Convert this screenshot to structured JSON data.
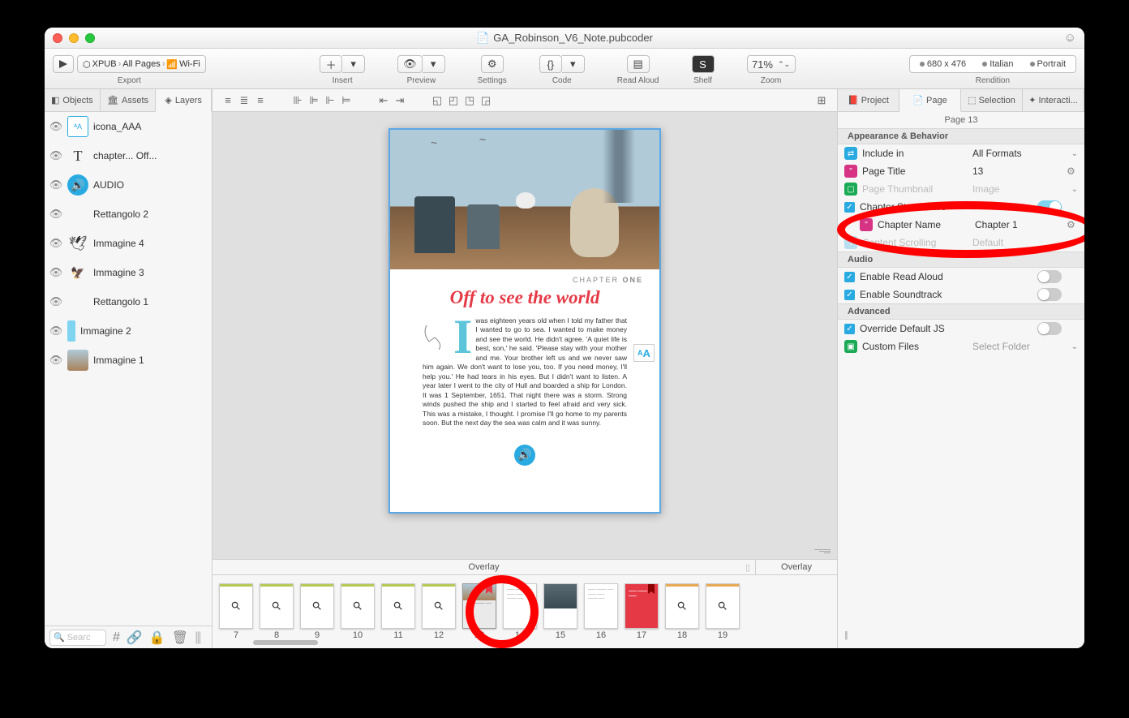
{
  "window": {
    "title": "GA_Robinson_V6_Note.pubcoder"
  },
  "toolbar": {
    "export_label": "Export",
    "breadcrumb": [
      "XPUB",
      "All Pages",
      "Wi-Fi"
    ],
    "insert": "Insert",
    "preview": "Preview",
    "settings": "Settings",
    "code": "Code",
    "read_aloud": "Read Aloud",
    "shelf": "Shelf",
    "zoom_label": "Zoom",
    "zoom_value": "71%",
    "rendition_label": "Rendition",
    "rendition": {
      "size": "680 x 476",
      "lang": "Italian",
      "orient": "Portrait"
    }
  },
  "left_tabs": {
    "objects": "Objects",
    "assets": "Assets",
    "layers": "Layers"
  },
  "layers": [
    {
      "name": "icona_AAA"
    },
    {
      "name": "chapter... Off..."
    },
    {
      "name": "AUDIO"
    },
    {
      "name": "Rettangolo 2"
    },
    {
      "name": "Immagine 4"
    },
    {
      "name": "Immagine 3"
    },
    {
      "name": "Rettangolo 1"
    },
    {
      "name": "Immagine 2"
    },
    {
      "name": "Immagine 1"
    }
  ],
  "search_placeholder": "Searc",
  "overlay_label": "Overlay",
  "thumbs": [
    {
      "num": "7"
    },
    {
      "num": "8"
    },
    {
      "num": "9"
    },
    {
      "num": "10"
    },
    {
      "num": "11"
    },
    {
      "num": "12"
    },
    {
      "num": "13",
      "selected": true
    },
    {
      "num": "14"
    },
    {
      "num": "15"
    },
    {
      "num": "16"
    },
    {
      "num": "17"
    },
    {
      "num": "18"
    },
    {
      "num": "19"
    }
  ],
  "right_tabs": {
    "project": "Project",
    "page": "Page",
    "selection": "Selection",
    "interact": "Interacti..."
  },
  "page_header": "Page 13",
  "sections": {
    "appearance": "Appearance & Behavior",
    "audio": "Audio",
    "advanced": "Advanced"
  },
  "props": {
    "include_in": {
      "label": "Include in",
      "value": "All Formats"
    },
    "page_title": {
      "label": "Page Title",
      "value": "13"
    },
    "page_thumbnail": {
      "label": "Page Thumbnail",
      "value": "Image"
    },
    "chapter_starts": {
      "label": "Chapter Starts Here"
    },
    "chapter_name": {
      "label": "Chapter Name",
      "value": "Chapter 1"
    },
    "content_scrolling": {
      "label": "Content Scrolling",
      "value": "Default"
    },
    "enable_read_aloud": {
      "label": "Enable Read Aloud"
    },
    "enable_soundtrack": {
      "label": "Enable Soundtrack"
    },
    "override_js": {
      "label": "Override Default JS"
    },
    "custom_files": {
      "label": "Custom Files",
      "value": "Select Folder"
    }
  },
  "page_content": {
    "chapter_label_prefix": "CHAPTER ",
    "chapter_label_num": "ONE",
    "title": "Off to see the world",
    "drop_cap": "I",
    "body": "was eighteen years old when I told my father that I wanted to go to sea. I wanted to make money and see the world. He didn't agree. 'A quiet life is best, son,' he said. 'Please stay with your mother and me. Your brother left us and we never saw him again. We don't want to lose you, too. If you need money, I'll help you.' He had tears in his eyes. But I didn't want to listen. A year later I went to the city of Hull and boarded a ship for London. It was 1 September, 1651. That night there was a storm. Strong winds pushed the ship and I started to feel afraid and very sick. This was a mistake, I thought. I promise I'll go home to my parents soon. But the next day the sea was calm and it was sunny."
  }
}
